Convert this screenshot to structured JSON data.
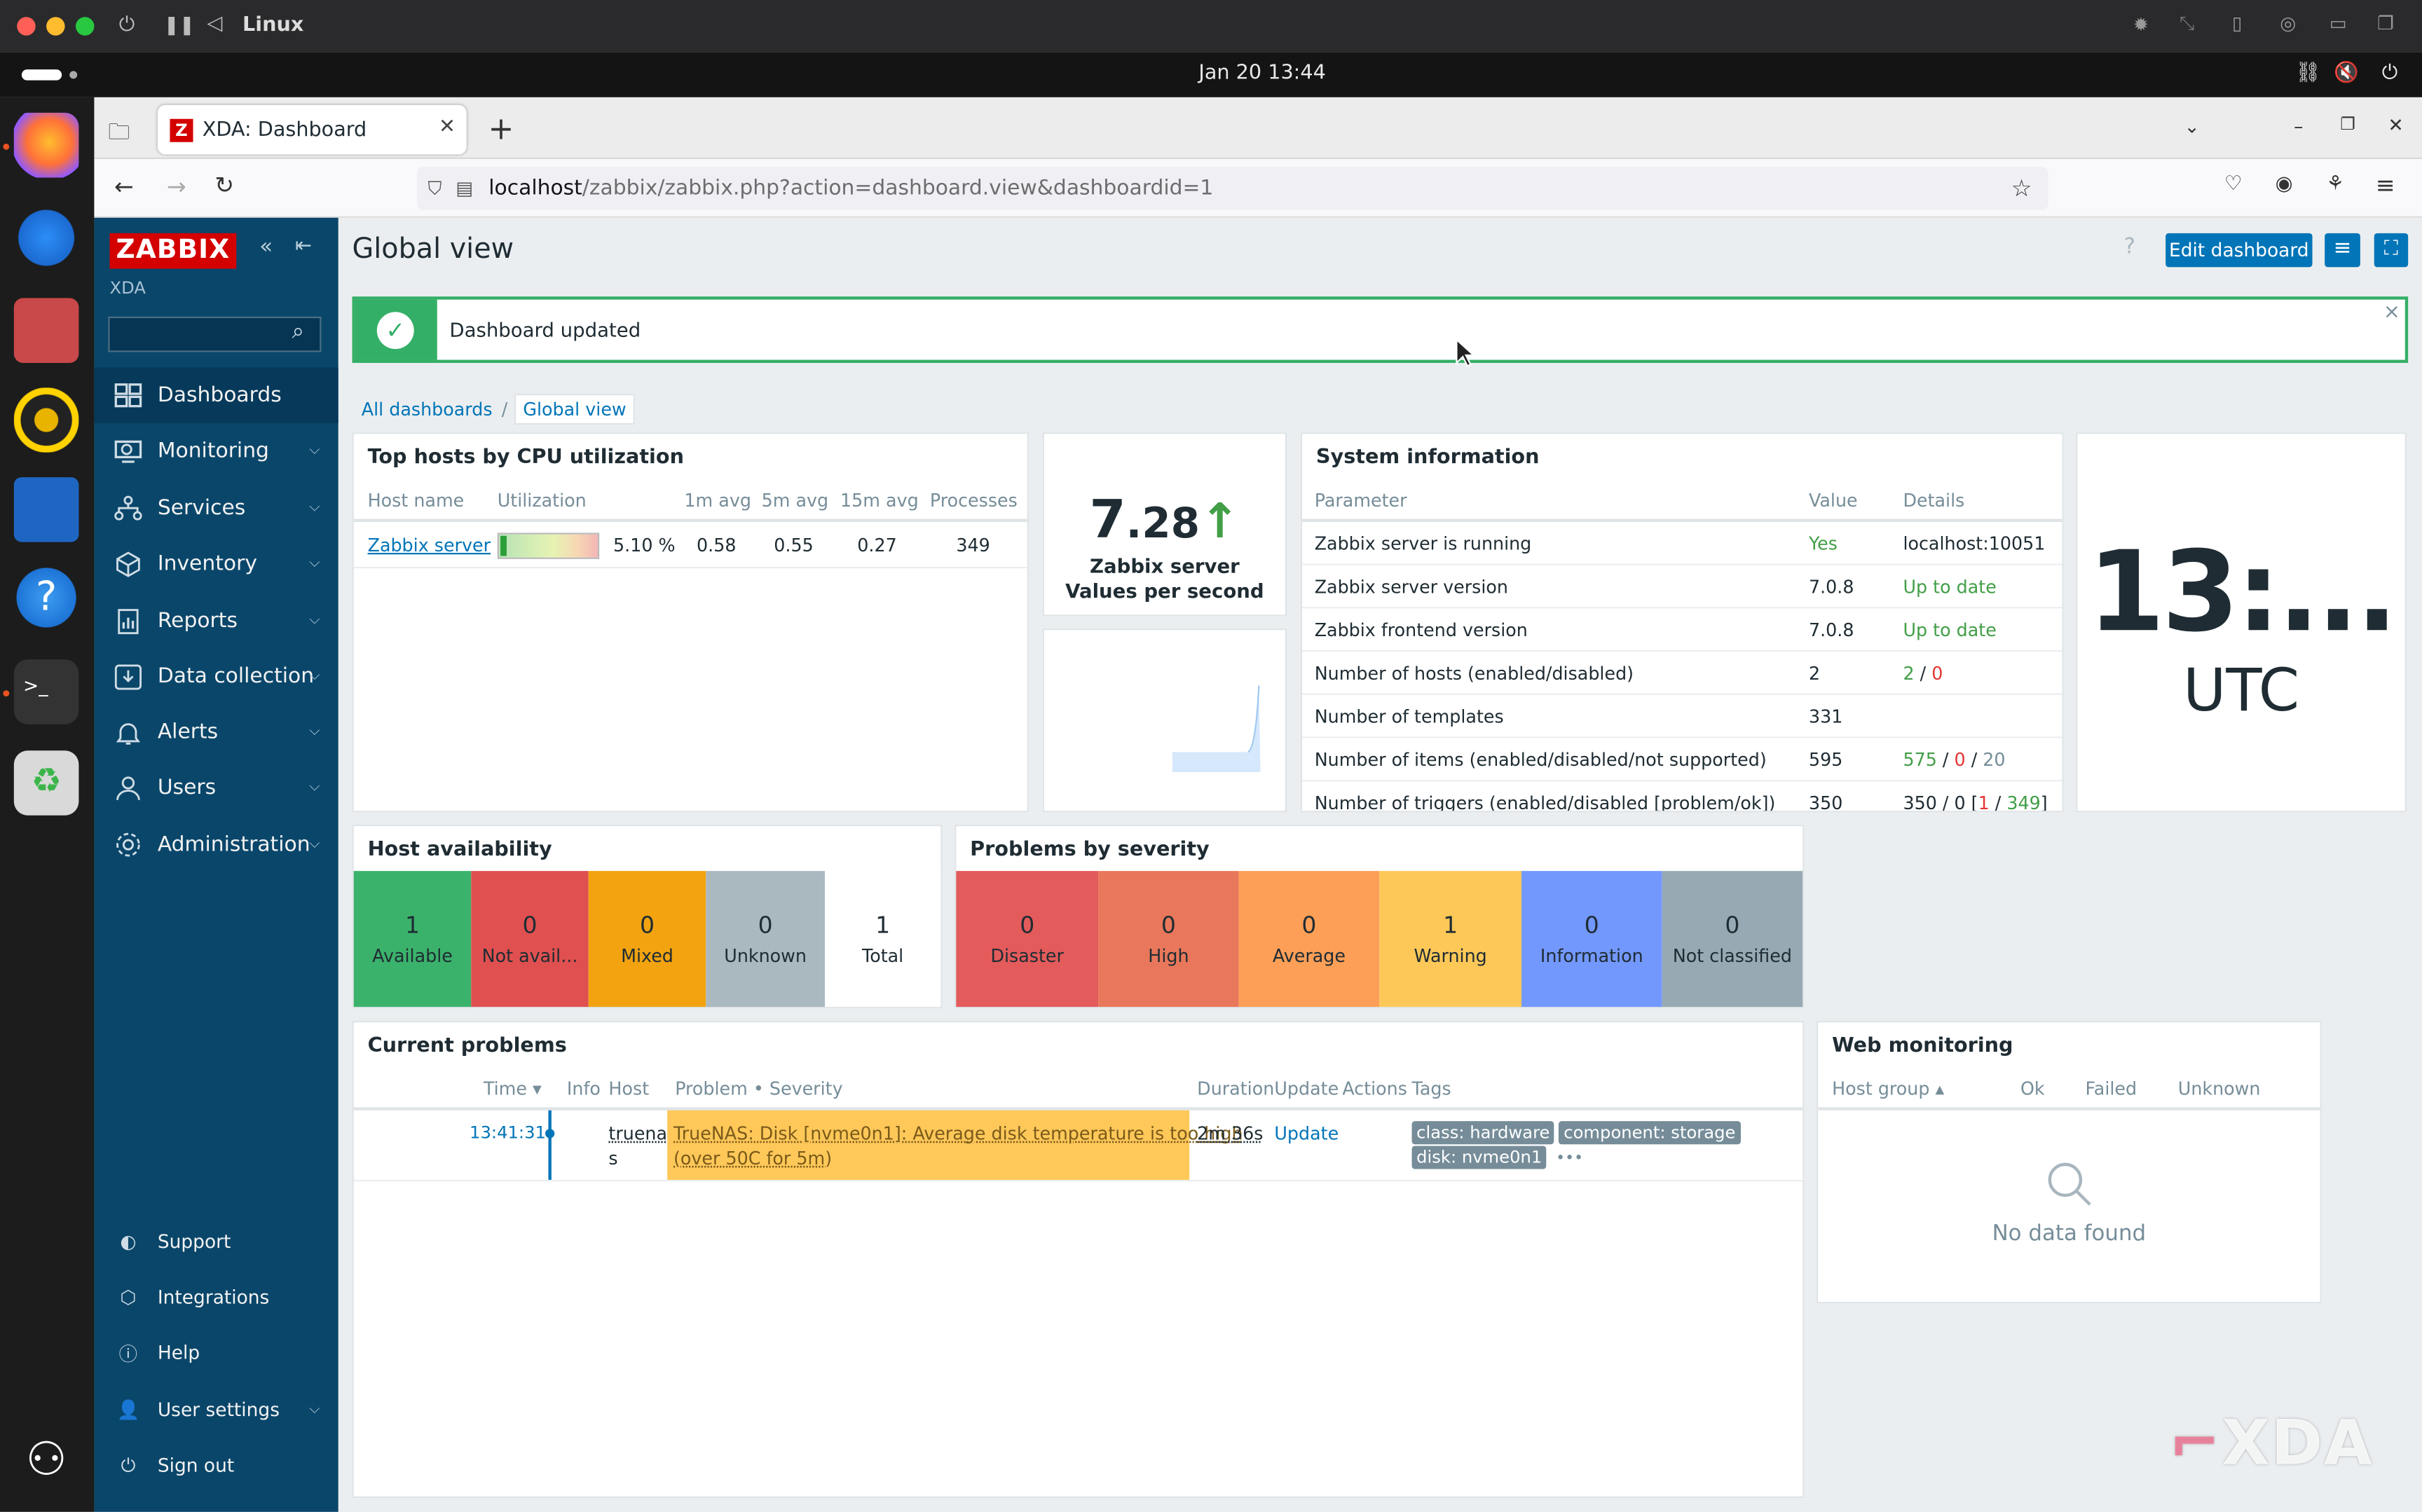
{
  "os": {
    "vm_name": "Linux",
    "datetime": "Jan 20  13:44"
  },
  "browser": {
    "tab_title": "XDA: Dashboard",
    "tab_favicon": "Z",
    "url_host": "localhost",
    "url_path": "/zabbix/zabbix.php?action=dashboard.view&dashboardid=1"
  },
  "sidebar": {
    "logo": "ZABBIX",
    "server_name": "XDA",
    "search_placeholder": "",
    "items": [
      {
        "label": "Dashboards",
        "icon": "dashboards-icon"
      },
      {
        "label": "Monitoring",
        "icon": "monitoring-icon"
      },
      {
        "label": "Services",
        "icon": "services-icon"
      },
      {
        "label": "Inventory",
        "icon": "inventory-icon"
      },
      {
        "label": "Reports",
        "icon": "reports-icon"
      },
      {
        "label": "Data collection",
        "icon": "data-collection-icon"
      },
      {
        "label": "Alerts",
        "icon": "alerts-icon"
      },
      {
        "label": "Users",
        "icon": "users-icon"
      },
      {
        "label": "Administration",
        "icon": "administration-icon"
      }
    ],
    "bottom": [
      {
        "label": "Support"
      },
      {
        "label": "Integrations"
      },
      {
        "label": "Help"
      },
      {
        "label": "User settings"
      },
      {
        "label": "Sign out"
      }
    ]
  },
  "header": {
    "title": "Global view",
    "help": "?",
    "edit_button": "Edit dashboard"
  },
  "message": {
    "text": "Dashboard updated",
    "close": "×"
  },
  "breadcrumb": {
    "all": "All dashboards",
    "sep": "/",
    "current": "Global view"
  },
  "top_hosts": {
    "title": "Top hosts by CPU utilization",
    "columns": [
      "Host name",
      "Utilization",
      "1m avg",
      "5m avg",
      "15m avg",
      "Processes"
    ],
    "rows": [
      {
        "host": "Zabbix server",
        "utilization": "5.10 %",
        "utilization_fraction": 0.051,
        "m1": "0.58",
        "m5": "0.55",
        "m15": "0.27",
        "processes": "349"
      }
    ]
  },
  "item_value": {
    "value_int": "7",
    "value_dec": ".28",
    "arrow": "↑",
    "line1": "Zabbix server",
    "line2": "Values per second"
  },
  "system_info": {
    "title": "System information",
    "columns": [
      "Parameter",
      "Value",
      "Details"
    ],
    "rows": [
      {
        "param": "Zabbix server is running",
        "value": "Yes",
        "details": "localhost:10051"
      },
      {
        "param": "Zabbix server version",
        "value": "7.0.8",
        "details": "Up to date"
      },
      {
        "param": "Zabbix frontend version",
        "value": "7.0.8",
        "details": "Up to date"
      },
      {
        "param": "Number of hosts (enabled/disabled)",
        "value": "2",
        "d1": "2",
        "d2": "0"
      },
      {
        "param": "Number of templates",
        "value": "331",
        "details": ""
      },
      {
        "param": "Number of items (enabled/disabled/not supported)",
        "value": "595",
        "d1": "575",
        "d2": "0",
        "d3": "20"
      },
      {
        "param": "Number of triggers (enabled/disabled [problem/ok])",
        "value": "350",
        "d1": "350 / 0 [",
        "d2": "1",
        "d3": "349",
        "d4": "]"
      }
    ]
  },
  "clock": {
    "time": "13:...",
    "zone": "UTC"
  },
  "host_availability": {
    "title": "Host availability",
    "boxes": [
      {
        "count": "1",
        "label": "Available",
        "color": "#59db8f"
      },
      {
        "count": "0",
        "label": "Not avail...",
        "color": "#e45959"
      },
      {
        "count": "0",
        "label": "Mixed",
        "color": "#ffa059"
      },
      {
        "count": "0",
        "label": "Unknown",
        "color": "#97aab3"
      },
      {
        "count": "1",
        "label": "Total",
        "color": "#ffffff"
      }
    ]
  },
  "problems_by_severity": {
    "title": "Problems by severity",
    "boxes": [
      {
        "count": "0",
        "label": "Disaster",
        "color": "#e45959"
      },
      {
        "count": "0",
        "label": "High",
        "color": "#e97659"
      },
      {
        "count": "0",
        "label": "Average",
        "color": "#ffa059"
      },
      {
        "count": "1",
        "label": "Warning",
        "color": "#ffc859"
      },
      {
        "count": "0",
        "label": "Information",
        "color": "#7499ff"
      },
      {
        "count": "0",
        "label": "Not classified",
        "color": "#97aab3"
      }
    ]
  },
  "current_problems": {
    "title": "Current problems",
    "columns": [
      "Time ▾",
      "Info",
      "Host",
      "Problem • Severity",
      "Duration",
      "Update",
      "Actions",
      "Tags"
    ],
    "rows": [
      {
        "time": "13:41:31",
        "host_l1": "truena",
        "host_l2": "s",
        "problem_l1": "TrueNAS: Disk [nvme0n1]: Average disk temperature is too high",
        "problem_l2": "(over 50C for 5m)",
        "duration": "2m 36s",
        "update": "Update",
        "tags": [
          "class: hardware",
          "component: storage",
          "disk: nvme0n1"
        ],
        "more": "•••"
      }
    ]
  },
  "web_monitoring": {
    "title": "Web monitoring",
    "columns": [
      "Host group ▴",
      "Ok",
      "Failed",
      "Unknown"
    ],
    "empty": "No data found"
  },
  "watermark": "XDA"
}
